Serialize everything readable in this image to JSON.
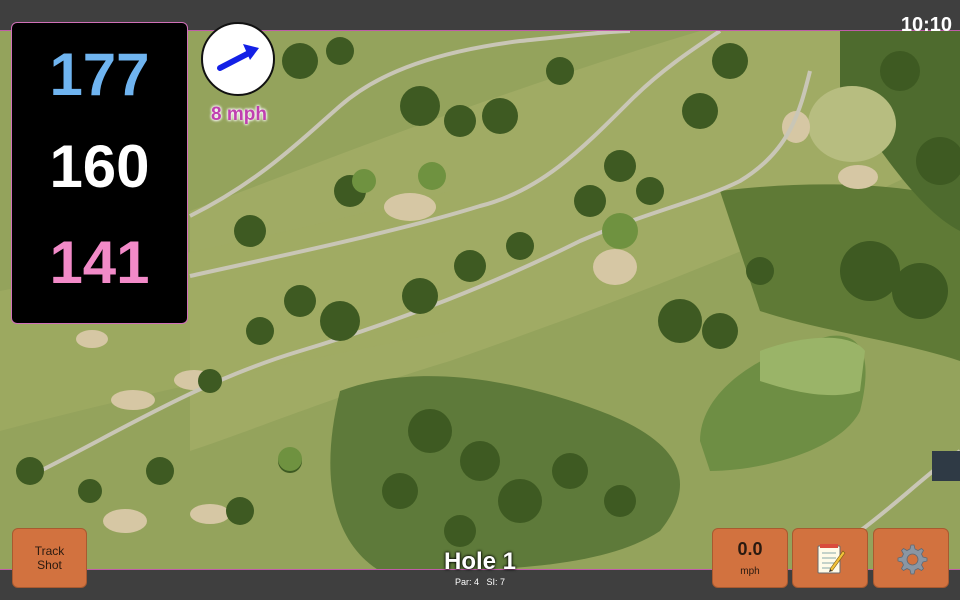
{
  "status": {
    "time": "10:10"
  },
  "distances": {
    "back": "177",
    "middle": "160",
    "front": "141"
  },
  "wind": {
    "speed": "8 mph",
    "direction_icon": "arrow-icon"
  },
  "buttons": {
    "track_shot_line1": "Track",
    "track_shot_line2": "Shot",
    "speed_value": "0.0",
    "speed_unit": "mph",
    "notes_icon": "notepad-icon",
    "settings_icon": "gear-icon"
  },
  "hole": {
    "title": "Hole 1",
    "par_label": "Par: 4",
    "si_label": "SI: 7"
  },
  "colors": {
    "back_distance": "#6fb4f0",
    "middle_distance": "#ffffff",
    "front_distance": "#f28ac8",
    "button": "#d2723f",
    "wind_text": "#c040b0"
  }
}
